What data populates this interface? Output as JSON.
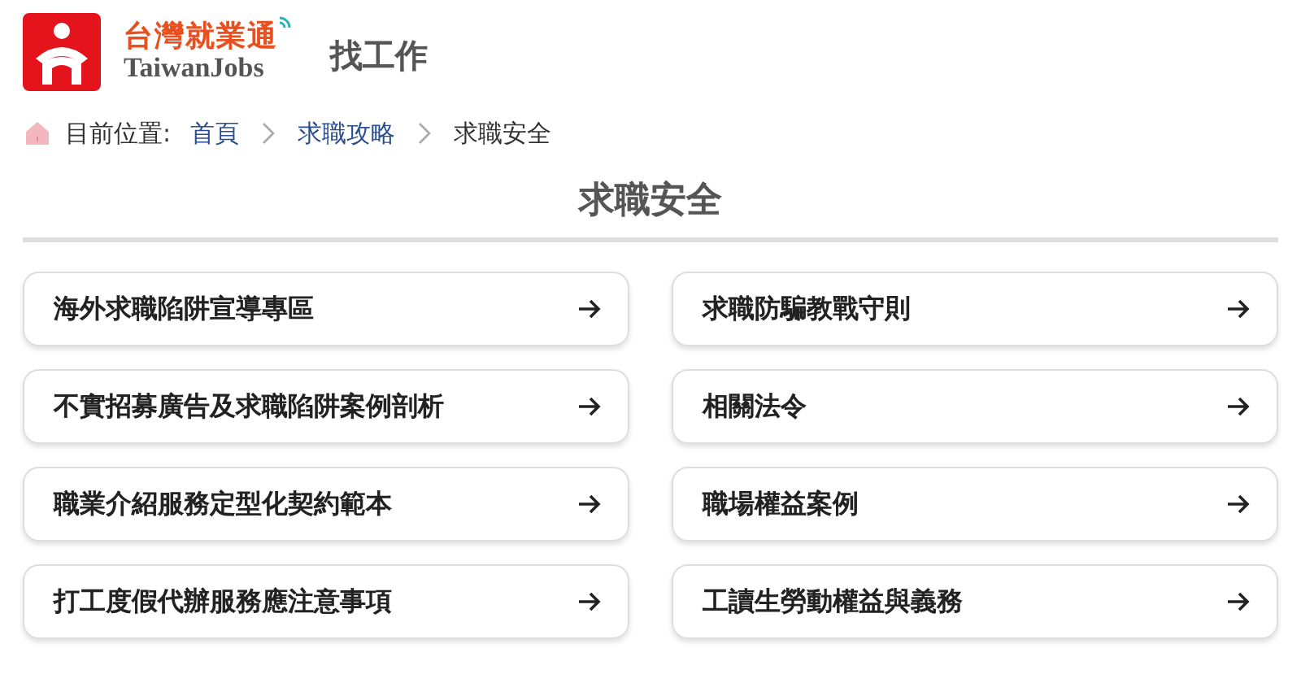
{
  "header": {
    "brand_cn": "台灣就業通",
    "brand_en": "TaiwanJobs",
    "section": "找工作"
  },
  "breadcrumb": {
    "label": "目前位置:",
    "items": [
      {
        "text": "首頁",
        "current": false
      },
      {
        "text": "求職攻略",
        "current": false
      },
      {
        "text": "求職安全",
        "current": true
      }
    ]
  },
  "page_title": "求職安全",
  "links": [
    {
      "text": "海外求職陷阱宣導專區"
    },
    {
      "text": "求職防騙教戰守則"
    },
    {
      "text": "不實招募廣告及求職陷阱案例剖析"
    },
    {
      "text": "相關法令"
    },
    {
      "text": "職業介紹服務定型化契約範本"
    },
    {
      "text": "職場權益案例"
    },
    {
      "text": "打工度假代辦服務應注意事項"
    },
    {
      "text": "工讀生勞動權益與義務"
    }
  ]
}
